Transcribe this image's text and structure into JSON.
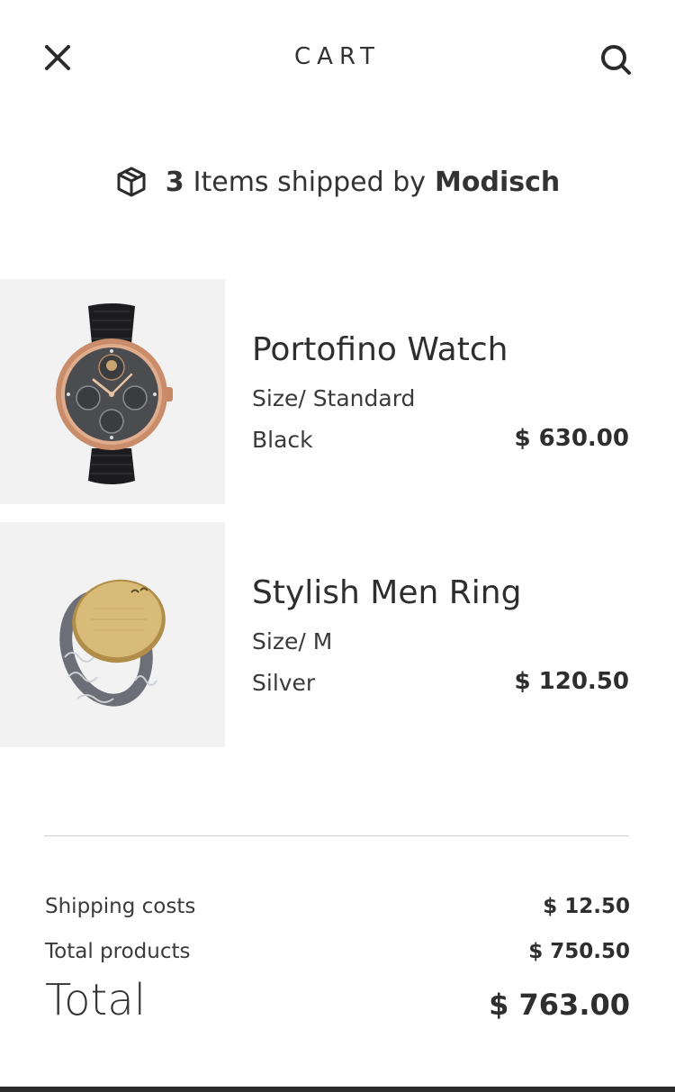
{
  "header": {
    "title": "CART",
    "close_icon": "close-icon",
    "search_icon": "search-icon"
  },
  "shipping": {
    "count": "3",
    "text": "Items shipped by",
    "seller": "Modisch",
    "icon": "package-icon"
  },
  "items": [
    {
      "name": "Portofino Watch",
      "size": "Size/ Standard",
      "color": "Black",
      "price": "$ 630.00",
      "image": "watch-image"
    },
    {
      "name": "Stylish Men Ring",
      "size": "Size/ M",
      "color": "Silver",
      "price": "$ 120.50",
      "image": "ring-image"
    }
  ],
  "summary": {
    "shipping_label": "Shipping costs",
    "shipping_value": "$ 12.50",
    "products_label": "Total products",
    "products_value": "$ 750.50",
    "total_label": "Total",
    "total_value": "$ 763.00"
  },
  "colors": {
    "text": "#2b2b2b",
    "thumb_bg": "#f2f2f3",
    "divider": "#cfcfcf"
  }
}
